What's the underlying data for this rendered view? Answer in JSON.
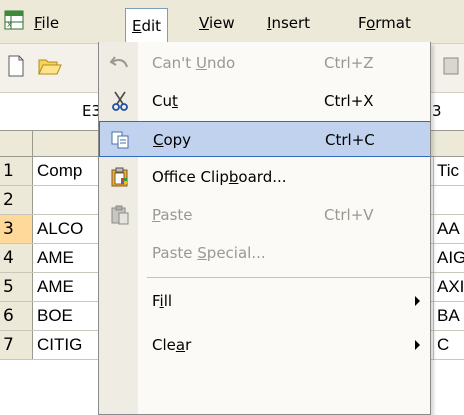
{
  "menubar": {
    "items": [
      {
        "label": "File",
        "u": "F",
        "rest": "ile"
      },
      {
        "label": "Edit",
        "u": "E",
        "rest": "dit"
      },
      {
        "label": "View",
        "u": "V",
        "rest": "iew"
      },
      {
        "label": "Insert",
        "u": "I",
        "rest": "nsert"
      },
      {
        "label": "Format",
        "pre": "F",
        "u": "o",
        "rest": "rmat"
      }
    ]
  },
  "namebox": {
    "value": "E3"
  },
  "formula_fragment": "3",
  "rows": [
    {
      "num": "1",
      "a": "Comp",
      "r": "Tic"
    },
    {
      "num": "2",
      "a": "",
      "r": ""
    },
    {
      "num": "3",
      "a": "ALCO",
      "r": "AA"
    },
    {
      "num": "4",
      "a": "AME",
      "r": "AIG"
    },
    {
      "num": "5",
      "a": "AME",
      "r": "AXI"
    },
    {
      "num": "6",
      "a": "BOE",
      "r": "BA"
    },
    {
      "num": "7",
      "a": "CITIG",
      "r": "C"
    }
  ],
  "edit_menu": {
    "undo": {
      "pre": "Can't ",
      "u": "U",
      "rest": "ndo",
      "shortcut": "Ctrl+Z"
    },
    "cut": {
      "pre": "Cu",
      "u": "t",
      "rest": "",
      "shortcut": "Ctrl+X"
    },
    "copy": {
      "pre": "",
      "u": "C",
      "rest": "opy",
      "shortcut": "Ctrl+C"
    },
    "clipboard": {
      "pre": "Office Clip",
      "u": "b",
      "rest": "oard..."
    },
    "paste": {
      "pre": "",
      "u": "P",
      "rest": "aste",
      "shortcut": "Ctrl+V"
    },
    "paste_special": {
      "pre": "Paste ",
      "u": "S",
      "rest": "pecial..."
    },
    "fill": {
      "pre": "F",
      "u": "i",
      "rest": "ll"
    },
    "clear": {
      "pre": "Cle",
      "u": "a",
      "rest": "r"
    }
  }
}
